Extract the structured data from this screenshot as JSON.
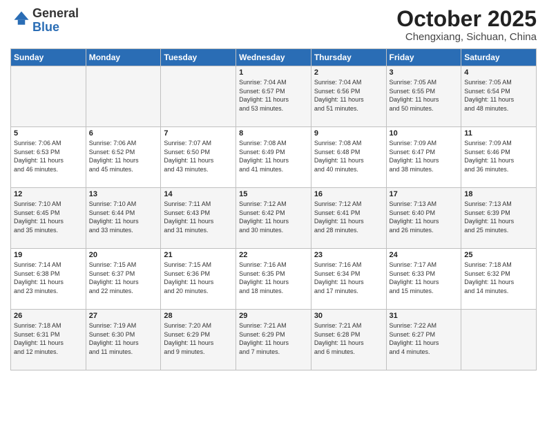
{
  "header": {
    "logo_line1": "General",
    "logo_line2": "Blue",
    "month": "October 2025",
    "location": "Chengxiang, Sichuan, China"
  },
  "weekdays": [
    "Sunday",
    "Monday",
    "Tuesday",
    "Wednesday",
    "Thursday",
    "Friday",
    "Saturday"
  ],
  "weeks": [
    [
      {
        "day": "",
        "info": ""
      },
      {
        "day": "",
        "info": ""
      },
      {
        "day": "",
        "info": ""
      },
      {
        "day": "1",
        "info": "Sunrise: 7:04 AM\nSunset: 6:57 PM\nDaylight: 11 hours\nand 53 minutes."
      },
      {
        "day": "2",
        "info": "Sunrise: 7:04 AM\nSunset: 6:56 PM\nDaylight: 11 hours\nand 51 minutes."
      },
      {
        "day": "3",
        "info": "Sunrise: 7:05 AM\nSunset: 6:55 PM\nDaylight: 11 hours\nand 50 minutes."
      },
      {
        "day": "4",
        "info": "Sunrise: 7:05 AM\nSunset: 6:54 PM\nDaylight: 11 hours\nand 48 minutes."
      }
    ],
    [
      {
        "day": "5",
        "info": "Sunrise: 7:06 AM\nSunset: 6:53 PM\nDaylight: 11 hours\nand 46 minutes."
      },
      {
        "day": "6",
        "info": "Sunrise: 7:06 AM\nSunset: 6:52 PM\nDaylight: 11 hours\nand 45 minutes."
      },
      {
        "day": "7",
        "info": "Sunrise: 7:07 AM\nSunset: 6:50 PM\nDaylight: 11 hours\nand 43 minutes."
      },
      {
        "day": "8",
        "info": "Sunrise: 7:08 AM\nSunset: 6:49 PM\nDaylight: 11 hours\nand 41 minutes."
      },
      {
        "day": "9",
        "info": "Sunrise: 7:08 AM\nSunset: 6:48 PM\nDaylight: 11 hours\nand 40 minutes."
      },
      {
        "day": "10",
        "info": "Sunrise: 7:09 AM\nSunset: 6:47 PM\nDaylight: 11 hours\nand 38 minutes."
      },
      {
        "day": "11",
        "info": "Sunrise: 7:09 AM\nSunset: 6:46 PM\nDaylight: 11 hours\nand 36 minutes."
      }
    ],
    [
      {
        "day": "12",
        "info": "Sunrise: 7:10 AM\nSunset: 6:45 PM\nDaylight: 11 hours\nand 35 minutes."
      },
      {
        "day": "13",
        "info": "Sunrise: 7:10 AM\nSunset: 6:44 PM\nDaylight: 11 hours\nand 33 minutes."
      },
      {
        "day": "14",
        "info": "Sunrise: 7:11 AM\nSunset: 6:43 PM\nDaylight: 11 hours\nand 31 minutes."
      },
      {
        "day": "15",
        "info": "Sunrise: 7:12 AM\nSunset: 6:42 PM\nDaylight: 11 hours\nand 30 minutes."
      },
      {
        "day": "16",
        "info": "Sunrise: 7:12 AM\nSunset: 6:41 PM\nDaylight: 11 hours\nand 28 minutes."
      },
      {
        "day": "17",
        "info": "Sunrise: 7:13 AM\nSunset: 6:40 PM\nDaylight: 11 hours\nand 26 minutes."
      },
      {
        "day": "18",
        "info": "Sunrise: 7:13 AM\nSunset: 6:39 PM\nDaylight: 11 hours\nand 25 minutes."
      }
    ],
    [
      {
        "day": "19",
        "info": "Sunrise: 7:14 AM\nSunset: 6:38 PM\nDaylight: 11 hours\nand 23 minutes."
      },
      {
        "day": "20",
        "info": "Sunrise: 7:15 AM\nSunset: 6:37 PM\nDaylight: 11 hours\nand 22 minutes."
      },
      {
        "day": "21",
        "info": "Sunrise: 7:15 AM\nSunset: 6:36 PM\nDaylight: 11 hours\nand 20 minutes."
      },
      {
        "day": "22",
        "info": "Sunrise: 7:16 AM\nSunset: 6:35 PM\nDaylight: 11 hours\nand 18 minutes."
      },
      {
        "day": "23",
        "info": "Sunrise: 7:16 AM\nSunset: 6:34 PM\nDaylight: 11 hours\nand 17 minutes."
      },
      {
        "day": "24",
        "info": "Sunrise: 7:17 AM\nSunset: 6:33 PM\nDaylight: 11 hours\nand 15 minutes."
      },
      {
        "day": "25",
        "info": "Sunrise: 7:18 AM\nSunset: 6:32 PM\nDaylight: 11 hours\nand 14 minutes."
      }
    ],
    [
      {
        "day": "26",
        "info": "Sunrise: 7:18 AM\nSunset: 6:31 PM\nDaylight: 11 hours\nand 12 minutes."
      },
      {
        "day": "27",
        "info": "Sunrise: 7:19 AM\nSunset: 6:30 PM\nDaylight: 11 hours\nand 11 minutes."
      },
      {
        "day": "28",
        "info": "Sunrise: 7:20 AM\nSunset: 6:29 PM\nDaylight: 11 hours\nand 9 minutes."
      },
      {
        "day": "29",
        "info": "Sunrise: 7:21 AM\nSunset: 6:29 PM\nDaylight: 11 hours\nand 7 minutes."
      },
      {
        "day": "30",
        "info": "Sunrise: 7:21 AM\nSunset: 6:28 PM\nDaylight: 11 hours\nand 6 minutes."
      },
      {
        "day": "31",
        "info": "Sunrise: 7:22 AM\nSunset: 6:27 PM\nDaylight: 11 hours\nand 4 minutes."
      },
      {
        "day": "",
        "info": ""
      }
    ]
  ]
}
